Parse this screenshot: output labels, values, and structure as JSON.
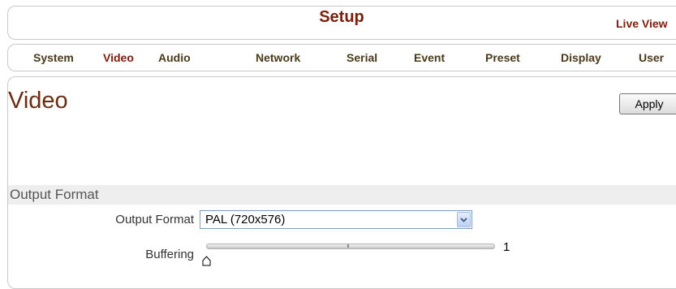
{
  "header": {
    "title": "Setup",
    "live_view": "Live View"
  },
  "tabs": [
    {
      "label": "System"
    },
    {
      "label": "Video"
    },
    {
      "label": "Audio"
    },
    {
      "label": "Network"
    },
    {
      "label": "Serial"
    },
    {
      "label": "Event"
    },
    {
      "label": "Preset"
    },
    {
      "label": "Display"
    },
    {
      "label": "User"
    }
  ],
  "active_tab": "Video",
  "page": {
    "title": "Video",
    "apply_label": "Apply"
  },
  "output_format_section": {
    "title": "Output Format",
    "output_format_label": "Output Format",
    "output_format_value": "PAL (720x576)",
    "buffering_label": "Buffering",
    "buffering_value": "1"
  },
  "colors": {
    "accent": "#7b1e0c",
    "tab_text": "#4a3a1a",
    "section_bg": "#eeeeee"
  },
  "icons": {
    "select_arrow": "chevron-down-icon",
    "slider_thumb": "slider-thumb-icon"
  }
}
